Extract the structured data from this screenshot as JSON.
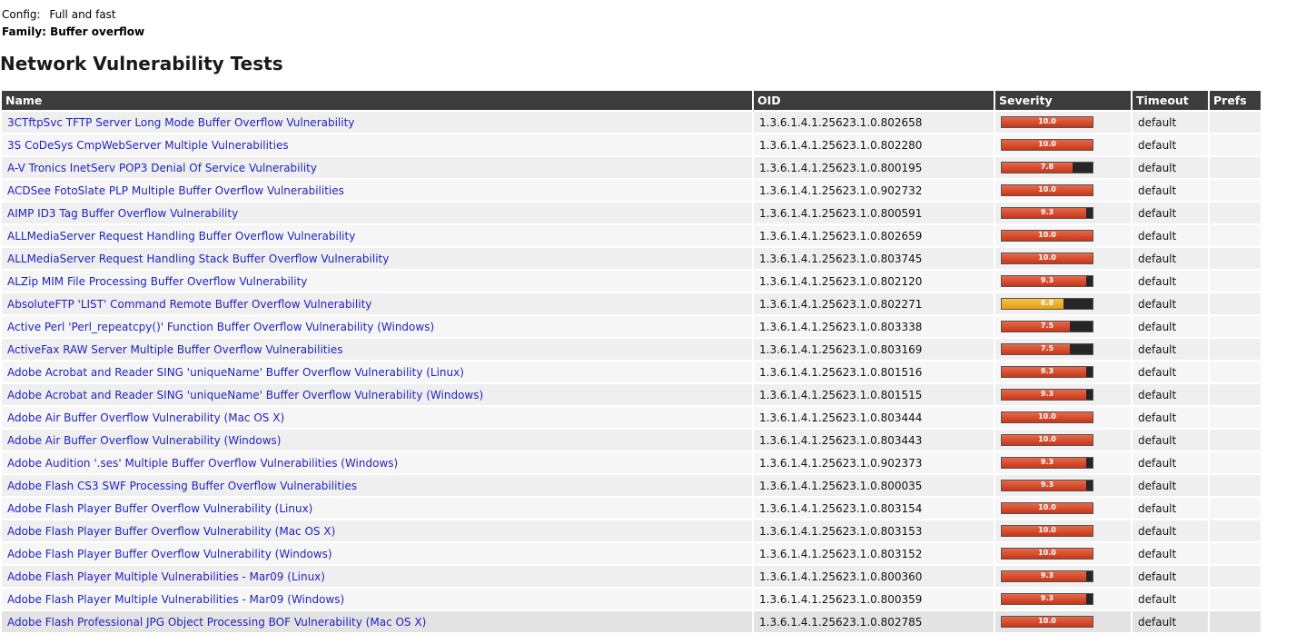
{
  "config": {
    "label": "Config:",
    "value": "Full and fast"
  },
  "family": {
    "text": "Family: Buffer overflow"
  },
  "section_title": "Network Vulnerability Tests",
  "columns": {
    "name": "Name",
    "oid": "OID",
    "severity": "Severity",
    "timeout": "Timeout",
    "prefs": "Prefs"
  },
  "colors": {
    "high": "#d0401f",
    "medium": "#eea520",
    "bar_bg": "#262626",
    "link": "#1f1fbf",
    "header_bg": "#3c3c3c"
  },
  "rows": [
    {
      "name": "3CTftpSvc TFTP Server Long Mode Buffer Overflow Vulnerability",
      "oid": "1.3.6.1.4.1.25623.1.0.802658",
      "severity": 10.0,
      "severity_label": "10.0",
      "timeout": "default",
      "prefs": ""
    },
    {
      "name": "3S CoDeSys CmpWebServer Multiple Vulnerabilities",
      "oid": "1.3.6.1.4.1.25623.1.0.802280",
      "severity": 10.0,
      "severity_label": "10.0",
      "timeout": "default",
      "prefs": ""
    },
    {
      "name": "A-V Tronics InetServ POP3 Denial Of Service Vulnerability",
      "oid": "1.3.6.1.4.1.25623.1.0.800195",
      "severity": 7.8,
      "severity_label": "7.8",
      "timeout": "default",
      "prefs": ""
    },
    {
      "name": "ACDSee FotoSlate PLP Multiple Buffer Overflow Vulnerabilities",
      "oid": "1.3.6.1.4.1.25623.1.0.902732",
      "severity": 10.0,
      "severity_label": "10.0",
      "timeout": "default",
      "prefs": ""
    },
    {
      "name": "AIMP ID3 Tag Buffer Overflow Vulnerability",
      "oid": "1.3.6.1.4.1.25623.1.0.800591",
      "severity": 9.3,
      "severity_label": "9.3",
      "timeout": "default",
      "prefs": ""
    },
    {
      "name": "ALLMediaServer Request Handling Buffer Overflow Vulnerability",
      "oid": "1.3.6.1.4.1.25623.1.0.802659",
      "severity": 10.0,
      "severity_label": "10.0",
      "timeout": "default",
      "prefs": ""
    },
    {
      "name": "ALLMediaServer Request Handling Stack Buffer Overflow Vulnerability",
      "oid": "1.3.6.1.4.1.25623.1.0.803745",
      "severity": 10.0,
      "severity_label": "10.0",
      "timeout": "default",
      "prefs": ""
    },
    {
      "name": "ALZip MIM File Processing Buffer Overflow Vulnerability",
      "oid": "1.3.6.1.4.1.25623.1.0.802120",
      "severity": 9.3,
      "severity_label": "9.3",
      "timeout": "default",
      "prefs": ""
    },
    {
      "name": "AbsoluteFTP 'LIST' Command Remote Buffer Overflow Vulnerability",
      "oid": "1.3.6.1.4.1.25623.1.0.802271",
      "severity": 6.8,
      "severity_label": "6.8",
      "timeout": "default",
      "prefs": ""
    },
    {
      "name": "Active Perl 'Perl_repeatcpy()' Function Buffer Overflow Vulnerability (Windows)",
      "oid": "1.3.6.1.4.1.25623.1.0.803338",
      "severity": 7.5,
      "severity_label": "7.5",
      "timeout": "default",
      "prefs": ""
    },
    {
      "name": "ActiveFax RAW Server Multiple Buffer Overflow Vulnerabilities",
      "oid": "1.3.6.1.4.1.25623.1.0.803169",
      "severity": 7.5,
      "severity_label": "7.5",
      "timeout": "default",
      "prefs": ""
    },
    {
      "name": "Adobe Acrobat and Reader SING 'uniqueName' Buffer Overflow Vulnerability (Linux)",
      "oid": "1.3.6.1.4.1.25623.1.0.801516",
      "severity": 9.3,
      "severity_label": "9.3",
      "timeout": "default",
      "prefs": ""
    },
    {
      "name": "Adobe Acrobat and Reader SING 'uniqueName' Buffer Overflow Vulnerability (Windows)",
      "oid": "1.3.6.1.4.1.25623.1.0.801515",
      "severity": 9.3,
      "severity_label": "9.3",
      "timeout": "default",
      "prefs": ""
    },
    {
      "name": "Adobe Air Buffer Overflow Vulnerability (Mac OS X)",
      "oid": "1.3.6.1.4.1.25623.1.0.803444",
      "severity": 10.0,
      "severity_label": "10.0",
      "timeout": "default",
      "prefs": ""
    },
    {
      "name": "Adobe Air Buffer Overflow Vulnerability (Windows)",
      "oid": "1.3.6.1.4.1.25623.1.0.803443",
      "severity": 10.0,
      "severity_label": "10.0",
      "timeout": "default",
      "prefs": ""
    },
    {
      "name": "Adobe Audition '.ses' Multiple Buffer Overflow Vulnerabilities (Windows)",
      "oid": "1.3.6.1.4.1.25623.1.0.902373",
      "severity": 9.3,
      "severity_label": "9.3",
      "timeout": "default",
      "prefs": ""
    },
    {
      "name": "Adobe Flash CS3 SWF Processing Buffer Overflow Vulnerabilities",
      "oid": "1.3.6.1.4.1.25623.1.0.800035",
      "severity": 9.3,
      "severity_label": "9.3",
      "timeout": "default",
      "prefs": ""
    },
    {
      "name": "Adobe Flash Player Buffer Overflow Vulnerability (Linux)",
      "oid": "1.3.6.1.4.1.25623.1.0.803154",
      "severity": 10.0,
      "severity_label": "10.0",
      "timeout": "default",
      "prefs": ""
    },
    {
      "name": "Adobe Flash Player Buffer Overflow Vulnerability (Mac OS X)",
      "oid": "1.3.6.1.4.1.25623.1.0.803153",
      "severity": 10.0,
      "severity_label": "10.0",
      "timeout": "default",
      "prefs": ""
    },
    {
      "name": "Adobe Flash Player Buffer Overflow Vulnerability (Windows)",
      "oid": "1.3.6.1.4.1.25623.1.0.803152",
      "severity": 10.0,
      "severity_label": "10.0",
      "timeout": "default",
      "prefs": ""
    },
    {
      "name": "Adobe Flash Player Multiple Vulnerabilities - Mar09 (Linux)",
      "oid": "1.3.6.1.4.1.25623.1.0.800360",
      "severity": 9.3,
      "severity_label": "9.3",
      "timeout": "default",
      "prefs": ""
    },
    {
      "name": "Adobe Flash Player Multiple Vulnerabilities - Mar09 (Windows)",
      "oid": "1.3.6.1.4.1.25623.1.0.800359",
      "severity": 9.3,
      "severity_label": "9.3",
      "timeout": "default",
      "prefs": ""
    },
    {
      "name": "Adobe Flash Professional JPG Object Processing BOF Vulnerability (Mac OS X)",
      "oid": "1.3.6.1.4.1.25623.1.0.802785",
      "severity": 10.0,
      "severity_label": "10.0",
      "timeout": "default",
      "prefs": ""
    }
  ]
}
